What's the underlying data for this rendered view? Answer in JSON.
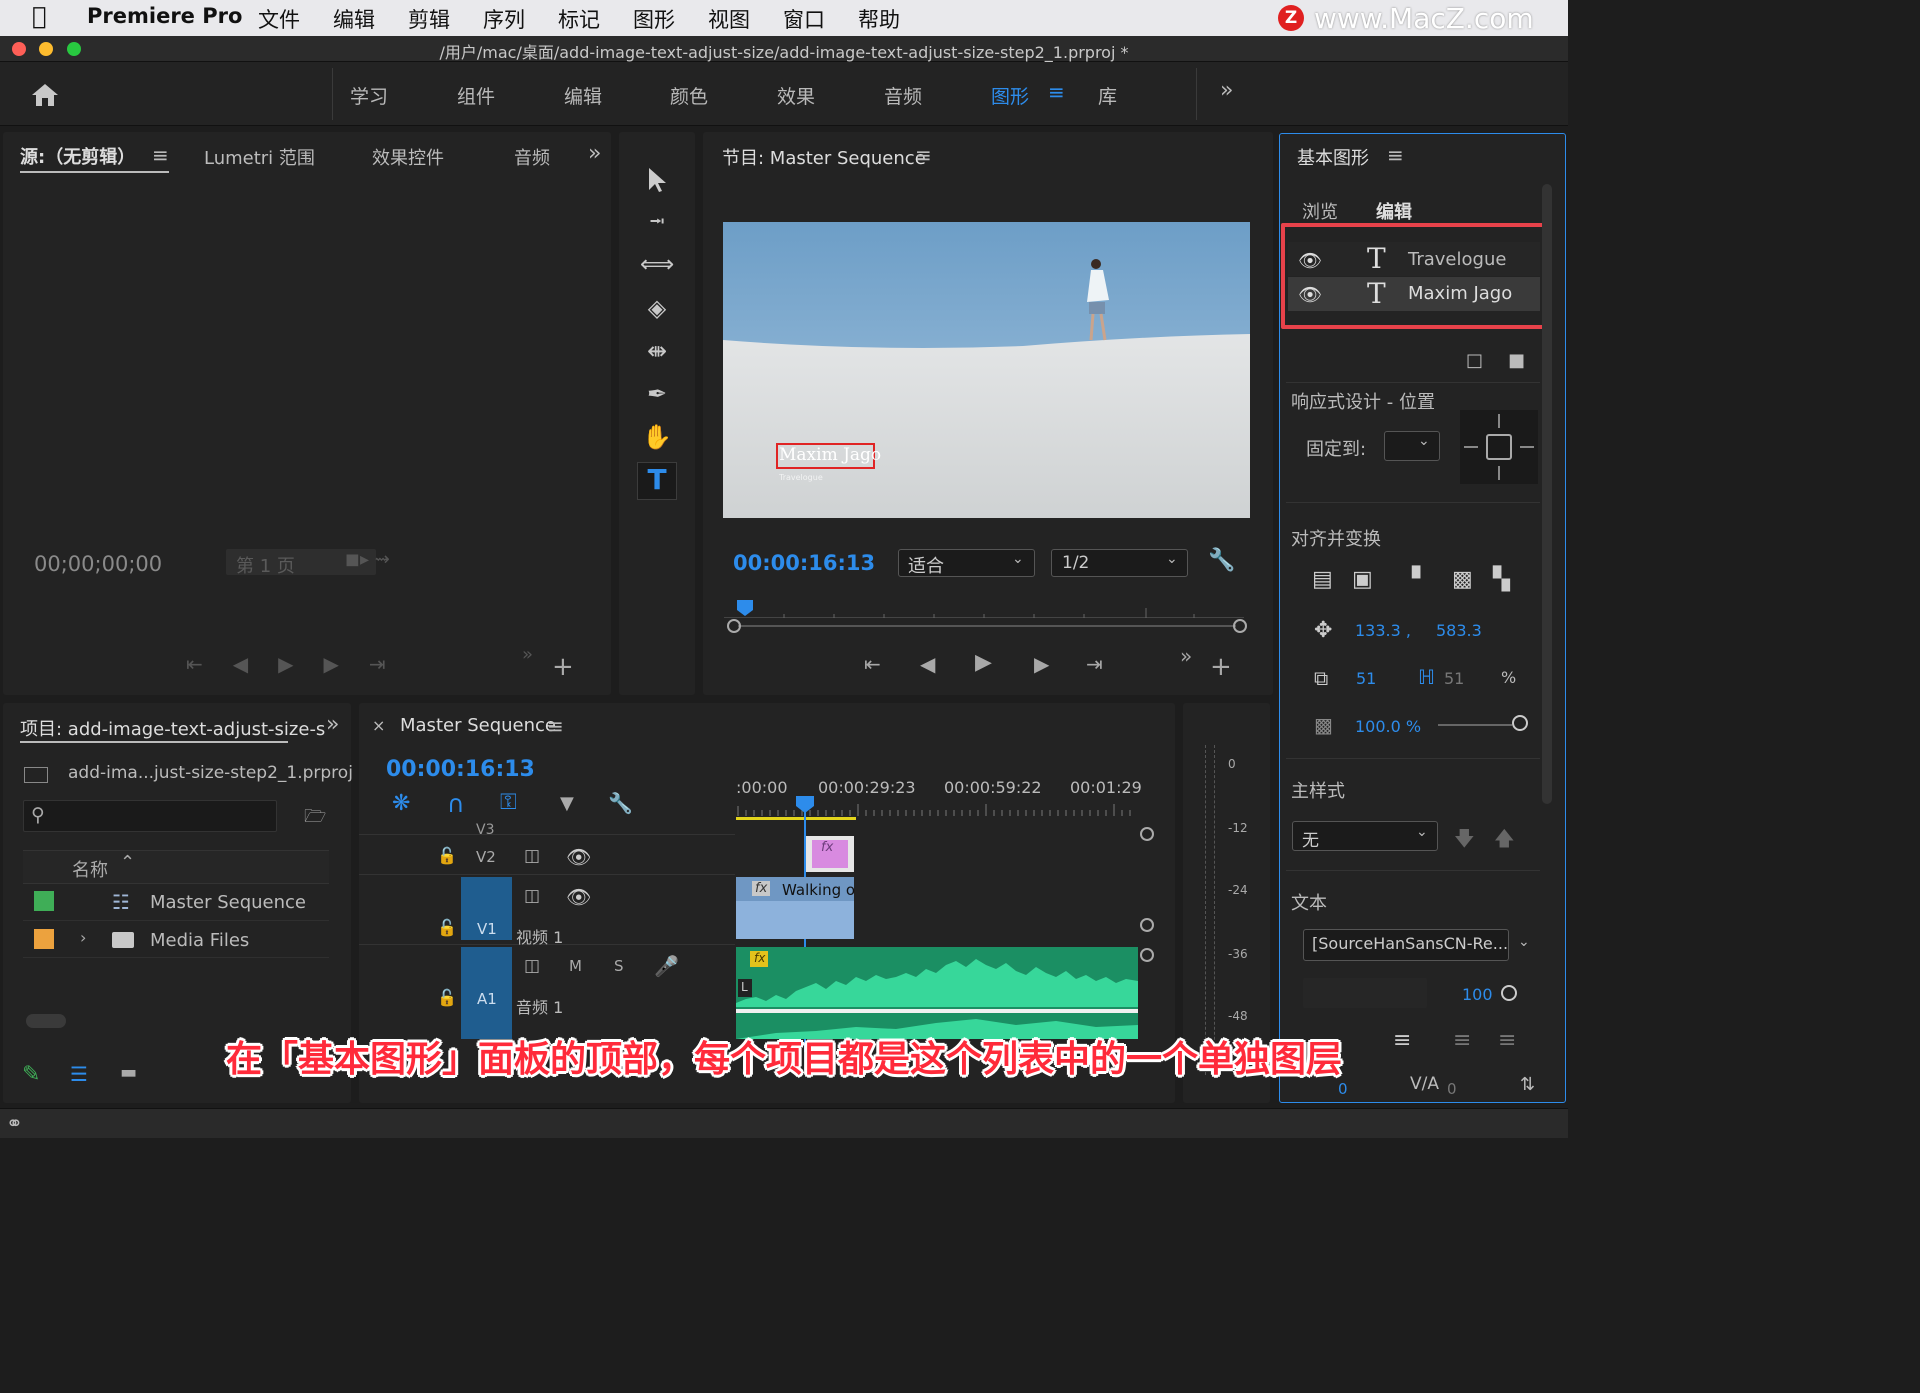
{
  "menubar": {
    "app": "Premiere Pro",
    "items": [
      "文件",
      "编辑",
      "剪辑",
      "序列",
      "标记",
      "图形",
      "视图",
      "窗口",
      "帮助"
    ],
    "watermark": "www.MacZ.com"
  },
  "window": {
    "title": "/用户/mac/桌面/add-image-text-adjust-size/add-image-text-adjust-size-step2_1.prproj *"
  },
  "workspaces": {
    "items": [
      "学习",
      "组件",
      "编辑",
      "颜色",
      "效果",
      "音频",
      "图形",
      "库"
    ],
    "active": "图形"
  },
  "source_panel": {
    "tabs": [
      "源:（无剪辑）",
      "Lumetri 范围",
      "效果控件",
      "音频"
    ],
    "timecode": "00;00;00;00",
    "page": "第 1 页"
  },
  "program_panel": {
    "title": "节目: Master Sequence",
    "timecode": "00:00:16:13",
    "fit": "适合",
    "resolution": "1/2",
    "overlay_title": "Maxim Jago",
    "overlay_sub": "Travelogue"
  },
  "project_panel": {
    "title": "项目: add-image-text-adjust-size-s",
    "file": "add-ima...just-size-step2_1.prproj",
    "column_name": "名称",
    "items": [
      {
        "name": "Master Sequence",
        "color": "#3fae57"
      },
      {
        "name": "Media Files",
        "color": "#eca23e"
      }
    ]
  },
  "timeline": {
    "title": "Master Sequence",
    "timecode": "00:00:16:13",
    "ruler": [
      ":00:00",
      "00:00:29:23",
      "00:00:59:22",
      "00:01:29"
    ],
    "tracks": {
      "v3": "V3",
      "v2": "V2",
      "v1": "V1",
      "v1_name": "视频 1",
      "a1": "A1",
      "a1_name": "音频 1",
      "m": "M",
      "s": "S"
    },
    "clip_v1": "Walking o",
    "fx": "fx"
  },
  "meter": {
    "labels": [
      "0",
      "-12",
      "-24",
      "-36",
      "-48"
    ]
  },
  "essential_graphics": {
    "title": "基本图形",
    "tabs": [
      "浏览",
      "编辑"
    ],
    "layers": [
      "Travelogue",
      "Maxim Jago"
    ],
    "responsive": "响应式设计 - 位置",
    "pin_to": "固定到:",
    "align": "对齐并变换",
    "pos_x": "133.3 ,",
    "pos_y": "583.3",
    "scale": "51",
    "scale2": "51",
    "percent": "%",
    "opacity": "100.0 %",
    "master_style": "主样式",
    "style_value": "无",
    "text_section": "文本",
    "font": "[SourceHanSansCN-Re...",
    "font_size": "100",
    "tracking": "0",
    "kerning": "0"
  },
  "caption": "在「基本图形」面板的顶部，每个项目都是这个列表中的一个单独图层"
}
